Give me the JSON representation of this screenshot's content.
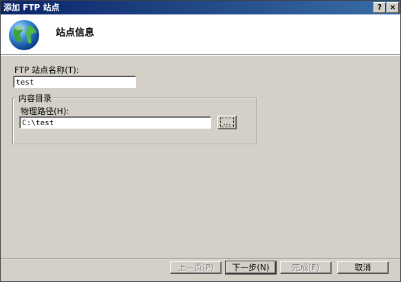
{
  "window": {
    "title": "添加 FTP 站点",
    "help_label": "?",
    "close_label": "×"
  },
  "header": {
    "heading": "站点信息",
    "icon": "globe-icon"
  },
  "form": {
    "site_name_label": "FTP 站点名称(T):",
    "site_name_value": "test",
    "content_group_label": "内容目录",
    "physical_path_label": "物理路径(H):",
    "physical_path_value": "C:\\test",
    "browse_label": "..."
  },
  "footer": {
    "prev_label": "上一页(P)",
    "next_label": "下一步(N)",
    "finish_label": "完成(F)",
    "cancel_label": "取消"
  },
  "colors": {
    "titlebar_start": "#0a246a",
    "titlebar_end": "#3a6ea5",
    "dialog_bg": "#d4d0c8"
  }
}
